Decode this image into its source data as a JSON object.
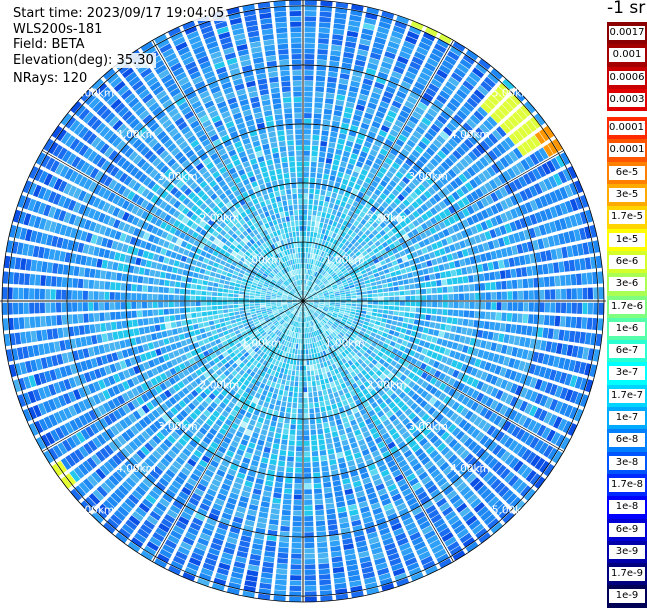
{
  "header": {
    "start_time": "Start time: 2023/09/17 19:04:05",
    "instrument": "WLS200s-181",
    "field": "Field: BETA",
    "elevation": "Elevation(deg): 35.30",
    "nrays": "NRays: 120"
  },
  "colorbar": {
    "unit_label": "-1 sr",
    "top_group": [
      {
        "label": "0.0017",
        "color": "#8b0000"
      },
      {
        "label": "0.001",
        "color": "#a40000"
      },
      {
        "label": "0.0006",
        "color": "#c80000"
      },
      {
        "label": "0.0003",
        "color": "#e10000"
      }
    ],
    "main_group": [
      {
        "label": "0.00017",
        "color": "#ff2a00"
      },
      {
        "label": "0.0001",
        "color": "#ff5500"
      },
      {
        "label": "6e-5",
        "color": "#ff7f00"
      },
      {
        "label": "3e-5",
        "color": "#ffaa00"
      },
      {
        "label": "1.7e-5",
        "color": "#ffd400"
      },
      {
        "label": "1e-5",
        "color": "#ffff00"
      },
      {
        "label": "6e-6",
        "color": "#d4ff2a"
      },
      {
        "label": "3e-6",
        "color": "#aaff55"
      },
      {
        "label": "1.7e-6",
        "color": "#7fff7f"
      },
      {
        "label": "1e-6",
        "color": "#55ffaa"
      },
      {
        "label": "6e-7",
        "color": "#2affd4"
      },
      {
        "label": "3e-7",
        "color": "#00ffff"
      },
      {
        "label": "1.7e-7",
        "color": "#00d4ff"
      },
      {
        "label": "1e-7",
        "color": "#00aaff"
      },
      {
        "label": "6e-8",
        "color": "#007fff"
      },
      {
        "label": "3e-8",
        "color": "#0055ff"
      },
      {
        "label": "1.7e-8",
        "color": "#002aff"
      },
      {
        "label": "1e-8",
        "color": "#0000ff"
      },
      {
        "label": "6e-9",
        "color": "#0000d4"
      },
      {
        "label": "3e-9",
        "color": "#0000aa"
      },
      {
        "label": "1.7e-9",
        "color": "#00007f"
      },
      {
        "label": "1e-9",
        "color": "#000055"
      }
    ]
  },
  "chart_data": {
    "type": "ppi",
    "field": "BETA",
    "elevation_deg": 35.3,
    "n_rays": 120,
    "rings_km": [
      1,
      2,
      3,
      4,
      5
    ],
    "ring_labels": [
      "1.00km",
      "2.00km",
      "3.00km",
      "4.00km",
      "5.00km"
    ],
    "max_range_km": 5.1,
    "spoke_step_deg": 30,
    "palette": [
      "#0a50e6",
      "#1a6cf0",
      "#1e88f5",
      "#2ea0f7",
      "#4ab4f2",
      "#22c8ee",
      "#5ad8f2",
      "#8fe8f8",
      "#c0f2fc"
    ],
    "highlights": [
      {
        "az_from": 42,
        "az_to": 58,
        "r_from": 4.5,
        "r_to": 5.0,
        "color": "#dfff3a"
      },
      {
        "az_from": 54,
        "az_to": 59,
        "r_from": 4.85,
        "r_to": 5.1,
        "color": "#ff9800"
      },
      {
        "az_from": 20,
        "az_to": 30,
        "r_from": 5.0,
        "r_to": 5.1,
        "color": "#d8ff40"
      },
      {
        "az_from": 230,
        "az_to": 238,
        "r_from": 4.9,
        "r_to": 5.1,
        "color": "#e6ff30"
      }
    ]
  }
}
